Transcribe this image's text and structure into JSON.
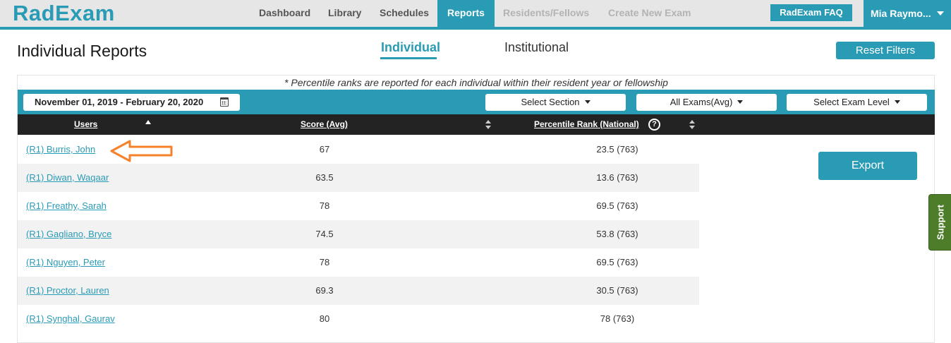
{
  "app": {
    "logo": "RadExam",
    "brand_color": "#2a9bb5"
  },
  "nav": {
    "items": [
      {
        "label": "Dashboard",
        "state": "normal"
      },
      {
        "label": "Library",
        "state": "normal"
      },
      {
        "label": "Schedules",
        "state": "normal"
      },
      {
        "label": "Reports",
        "state": "active"
      },
      {
        "label": "Residents/Fellows",
        "state": "disabled"
      },
      {
        "label": "Create New Exam",
        "state": "disabled"
      }
    ],
    "faq_label": "RadExam FAQ",
    "user_name": "Mia Raymo...",
    "user_menu_icon": "chevron-down-icon"
  },
  "header": {
    "title": "Individual Reports",
    "tabs": [
      {
        "label": "Individual",
        "active": true
      },
      {
        "label": "Institutional",
        "active": false
      }
    ],
    "reset_label": "Reset Filters"
  },
  "note": "* Percentile ranks are reported for each individual within their resident year or fellowship",
  "filters": {
    "date_range": "November 01, 2019 - February 20, 2020",
    "date_icon": "calendar-icon",
    "section": "Select Section",
    "exams": "All Exams(Avg)",
    "exam_level": "Select Exam Level"
  },
  "table": {
    "columns": {
      "users": "Users",
      "score": "Score (Avg)",
      "rank": "Percentile Rank (National)"
    },
    "help_icon": "?",
    "rows": [
      {
        "user": "(R1) Burris, John",
        "score": "67",
        "rank": "23.5 (763)"
      },
      {
        "user": "(R1) Diwan, Waqaar",
        "score": "63.5",
        "rank": "13.6 (763)"
      },
      {
        "user": "(R1) Freathy, Sarah",
        "score": "78",
        "rank": "69.5 (763)"
      },
      {
        "user": "(R1) Gagliano, Bryce",
        "score": "74.5",
        "rank": "53.8 (763)"
      },
      {
        "user": "(R1) Nguyen, Peter",
        "score": "78",
        "rank": "69.5 (763)"
      },
      {
        "user": "(R1) Proctor, Lauren",
        "score": "69.3",
        "rank": "30.5 (763)"
      },
      {
        "user": "(R1) Synghal, Gaurav",
        "score": "80",
        "rank": "78 (763)"
      }
    ]
  },
  "export_label": "Export",
  "support_label": "Support",
  "annotation": {
    "arrow_color": "#f5822a",
    "arrow_icon": "arrow-left-outline-icon"
  }
}
